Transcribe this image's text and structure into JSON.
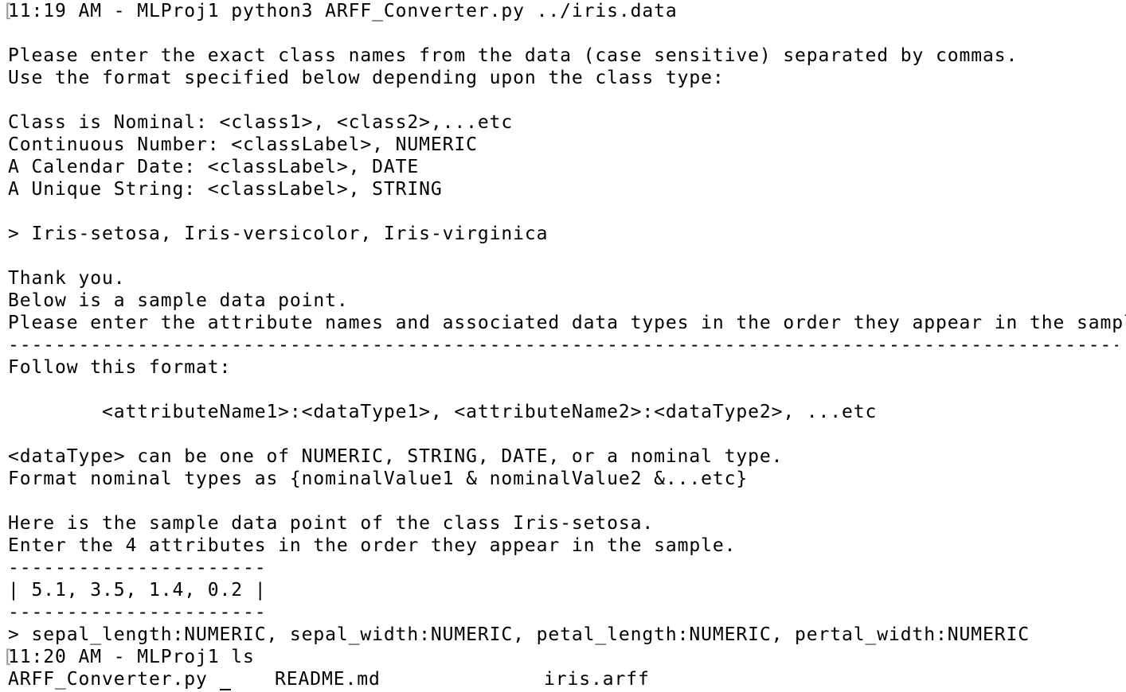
{
  "terminal": {
    "lines": [
      "11:19 AM - MLProj1 python3 ARFF_Converter.py ../iris.data",
      "",
      "Please enter the exact class names from the data (case sensitive) separated by commas.",
      "Use the format specified below depending upon the class type:",
      "",
      "Class is Nominal: <class1>, <class2>,...etc",
      "Continuous Number: <classLabel>, NUMERIC",
      "A Calendar Date: <classLabel>, DATE",
      "A Unique String: <classLabel>, STRING",
      "",
      "> Iris-setosa, Iris-versicolor, Iris-virginica",
      "",
      "Thank you.",
      "Below is a sample data point.",
      "Please enter the attribute names and associated data types in the order they appear in the sample.",
      "----------------------------------------------------------------------------------------------------",
      "Follow this format:",
      "",
      "        <attributeName1>:<dataType1>, <attributeName2>:<dataType2>, ...etc",
      "",
      "<dataType> can be one of NUMERIC, STRING, DATE, or a nominal type.",
      "Format nominal types as {nominalValue1 & nominalValue2 &...etc}",
      "",
      "Here is the sample data point of the class Iris-setosa.",
      "Enter the 4 attributes in the order they appear in the sample.",
      "----------------------",
      "| 5.1, 3.5, 1.4, 0.2 |",
      "----------------------",
      "> sepal_length:NUMERIC, sepal_width:NUMERIC, petal_length:NUMERIC, pertal_width:NUMERIC",
      "11:20 AM - MLProj1 ls"
    ],
    "ls_output": [
      "ARFF_Converter.py",
      "README.md",
      "iris.arff"
    ],
    "prompt_bracket": "["
  }
}
